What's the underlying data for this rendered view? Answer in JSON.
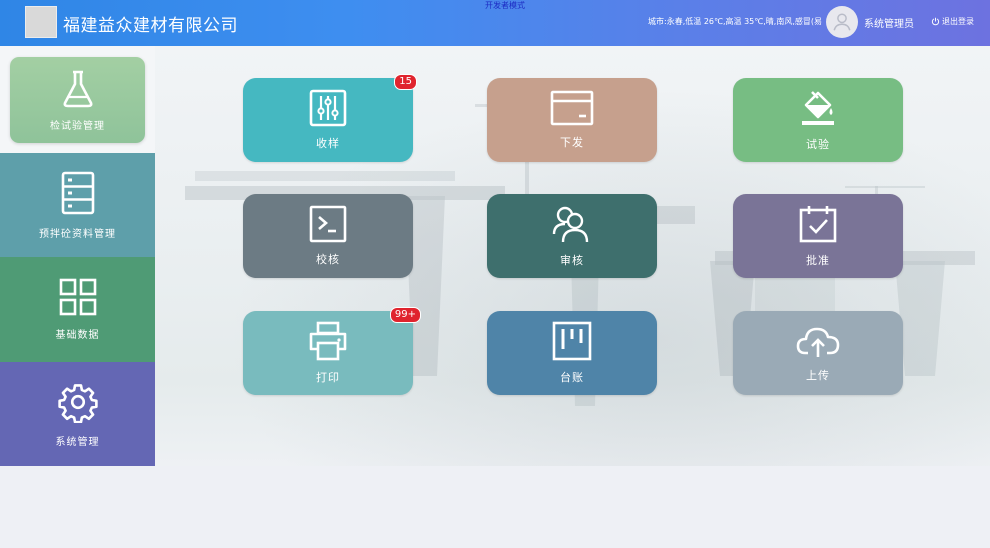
{
  "header": {
    "company": "福建益众建材有限公司",
    "dev_mode": "开发者模式",
    "weather": "城市:永春,低温 26℃,高温 35℃,晴,南风,感冒(易",
    "user": "系统管理员",
    "logout": "退出登录"
  },
  "sidebar": {
    "items": [
      {
        "label": "检试验管理",
        "icon": "flask-icon",
        "color": "#9dcb9f",
        "active": true
      },
      {
        "label": "预拌砼资料管理",
        "icon": "server-rack-icon",
        "color": "#5e9faa"
      },
      {
        "label": "基础数据",
        "icon": "grid-icon",
        "color": "#4f9b75"
      },
      {
        "label": "系统管理",
        "icon": "gear-icon",
        "color": "#6467b4"
      }
    ]
  },
  "tiles": [
    {
      "label": "收样",
      "icon": "sliders-icon",
      "color": "#45b8c1",
      "badge": "15"
    },
    {
      "label": "下发",
      "icon": "credit-card-icon",
      "color": "#c6a08d",
      "badge": ""
    },
    {
      "label": "试验",
      "icon": "paint-bucket-icon",
      "color": "#77bd83",
      "badge": ""
    },
    {
      "label": "校核",
      "icon": "terminal-icon",
      "color": "#6c7b84",
      "badge": ""
    },
    {
      "label": "审核",
      "icon": "users-icon",
      "color": "#3e6f6d",
      "badge": ""
    },
    {
      "label": "批准",
      "icon": "calendar-check-icon",
      "color": "#7a7497",
      "badge": ""
    },
    {
      "label": "打印",
      "icon": "printer-icon",
      "color": "#79bbbe",
      "badge": "99+"
    },
    {
      "label": "台账",
      "icon": "board-icon",
      "color": "#4f84a8",
      "badge": ""
    },
    {
      "label": "上传",
      "icon": "cloud-upload-icon",
      "color": "#9aaab6",
      "badge": ""
    }
  ]
}
